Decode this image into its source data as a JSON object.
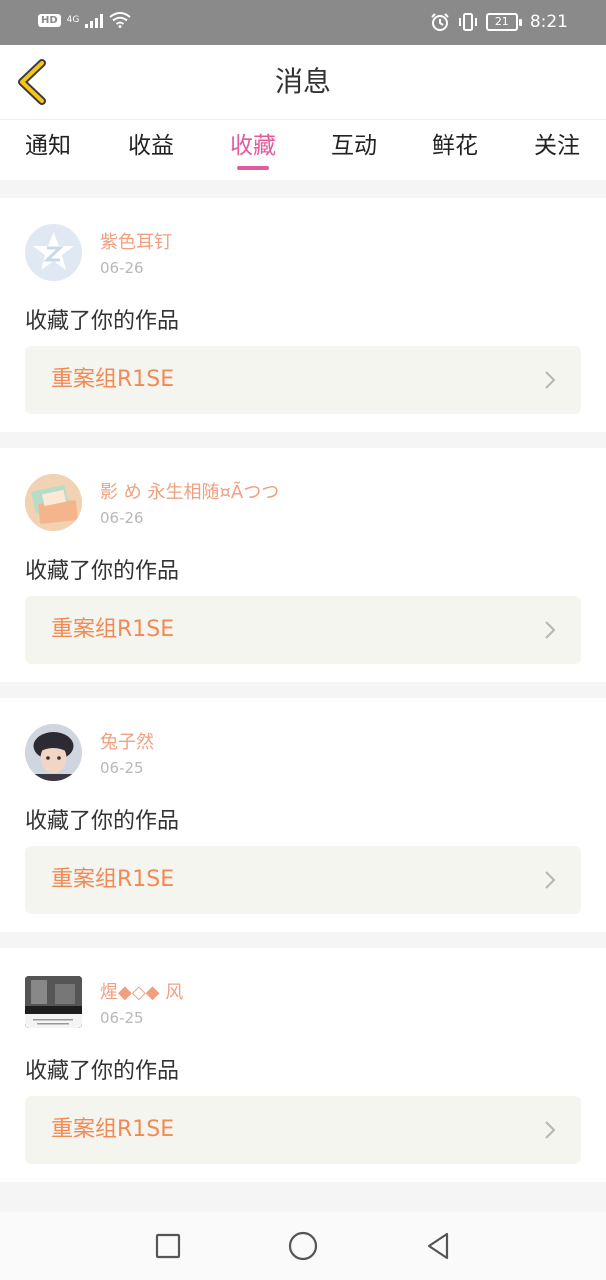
{
  "status_bar": {
    "hd": "HD",
    "network": "4G",
    "battery": "21",
    "time": "8:21"
  },
  "header": {
    "title": "消息"
  },
  "tabs": [
    {
      "label": "通知"
    },
    {
      "label": "收益"
    },
    {
      "label": "收藏",
      "active": true
    },
    {
      "label": "互动"
    },
    {
      "label": "鲜花"
    },
    {
      "label": "关注"
    }
  ],
  "messages": [
    {
      "username": "紫色耳钉",
      "date": "06-26",
      "action": "收藏了你的作品",
      "work": "重案组R1SE"
    },
    {
      "username": "影 め 永生相随¤Ãつつ",
      "date": "06-26",
      "action": "收藏了你的作品",
      "work": "重案组R1SE"
    },
    {
      "username": "兔子然",
      "date": "06-25",
      "action": "收藏了你的作品",
      "work": "重案组R1SE"
    },
    {
      "username": "煋◆◇◆ 风",
      "date": "06-25",
      "action": "收藏了你的作品",
      "work": "重案组R1SE"
    }
  ],
  "colors": {
    "accent": "#e45a9e",
    "username": "#f0a080",
    "work_title": "#f28a55",
    "back_icon": "#f5c518"
  },
  "icons": {
    "back": "chevron-left-icon",
    "work_arrow": "chevron-right-icon",
    "nav": [
      "square-icon",
      "circle-icon",
      "triangle-back-icon"
    ]
  }
}
